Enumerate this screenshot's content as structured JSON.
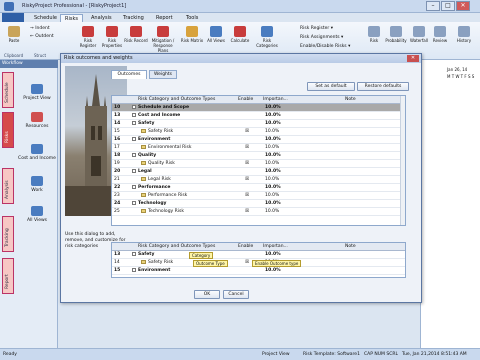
{
  "window": {
    "title": "RiskyProject Professional - [RiskyProject1]",
    "min": "–",
    "max": "□",
    "close": "✕"
  },
  "ribbon_tabs": [
    "Schedule",
    "Risks",
    "Analysis",
    "Tracking",
    "Report",
    "Tools"
  ],
  "ribbon": {
    "paste": "Paste",
    "indent": "Indent",
    "outdent": "Outdent",
    "clipboard_group": "Clipboard",
    "structure_group": "Struct",
    "buttons": [
      "Risk Register",
      "Risk Properties",
      "Risk Record",
      "Mitigation / Response Plans",
      "Risk Matrix",
      "All Views",
      "Calculate",
      "Risk Categories"
    ],
    "risk_register": "Risk Register ▾",
    "risk_assignments": "Risk Assignments ▾",
    "enable_disable": "Enable/Disable Risks ▾",
    "right_buttons": [
      "Risk",
      "Probability",
      "Waterfall",
      "Review",
      "History"
    ]
  },
  "workflow": {
    "title": "Workflow",
    "tabs": [
      "Schedule",
      "Risks",
      "Analysis",
      "Tracking",
      "Report"
    ],
    "items": [
      "Project View",
      "Resources",
      "Cost and Income",
      "Work",
      "All Views"
    ]
  },
  "dialog": {
    "title": "Risk outcomes and weights",
    "close": "✕",
    "tabs": [
      "Outcomes",
      "Weights"
    ],
    "set_default": "Set as default",
    "restore_defaults": "Restore defaults",
    "help_text": "Use this dialog to add, remove, and customize for risk categories",
    "ok": "OK",
    "cancel": "Cancel",
    "columns": [
      "Risk Category and Outcome Types",
      "Enable",
      "Importan...",
      "Note"
    ],
    "rows": [
      {
        "num": "10",
        "name": "Schedule and Scope",
        "enable": "",
        "imp": "10.0%",
        "type": "selected"
      },
      {
        "num": "13",
        "name": "Cost and Income",
        "enable": "",
        "imp": "10.0%",
        "type": "cat"
      },
      {
        "num": "14",
        "name": "Safety",
        "enable": "",
        "imp": "10.0%",
        "type": "cat"
      },
      {
        "num": "15",
        "name": "Safety Risk",
        "enable": "☒",
        "imp": "10.0%",
        "type": "risk"
      },
      {
        "num": "16",
        "name": "Environment",
        "enable": "",
        "imp": "10.0%",
        "type": "cat"
      },
      {
        "num": "17",
        "name": "Environmental Risk",
        "enable": "☒",
        "imp": "10.0%",
        "type": "risk"
      },
      {
        "num": "18",
        "name": "Quality",
        "enable": "",
        "imp": "10.0%",
        "type": "cat"
      },
      {
        "num": "19",
        "name": "Quality Risk",
        "enable": "☒",
        "imp": "10.0%",
        "type": "risk"
      },
      {
        "num": "20",
        "name": "Legal",
        "enable": "",
        "imp": "10.0%",
        "type": "cat"
      },
      {
        "num": "21",
        "name": "Legal Risk",
        "enable": "☒",
        "imp": "10.0%",
        "type": "risk"
      },
      {
        "num": "22",
        "name": "Performance",
        "enable": "",
        "imp": "10.0%",
        "type": "cat"
      },
      {
        "num": "23",
        "name": "Performance Risk",
        "enable": "☒",
        "imp": "10.0%",
        "type": "risk"
      },
      {
        "num": "24",
        "name": "Technology",
        "enable": "",
        "imp": "10.0%",
        "type": "cat"
      },
      {
        "num": "25",
        "name": "Technology Risk",
        "enable": "☒",
        "imp": "10.0%",
        "type": "risk"
      }
    ],
    "example_rows": [
      {
        "num": "13",
        "name": "Safety",
        "enable": "",
        "imp": "10.0%",
        "type": "cat"
      },
      {
        "num": "14",
        "name": "Safety Risk",
        "enable": "☒",
        "imp": "10.0%",
        "type": "risk"
      },
      {
        "num": "15",
        "name": "Environment",
        "enable": "",
        "imp": "10.0%",
        "type": "cat"
      }
    ],
    "tips": {
      "category": "Category",
      "outcome_type": "Outcome Type",
      "enable_outcome": "Enable Outcome type"
    }
  },
  "bg": {
    "date": "Jan 26, 14",
    "day_letters": "M T W T F S S"
  },
  "status": {
    "left": "Ready",
    "view": "Project View",
    "template": "Risk Template: Software1",
    "keys": "CAP NUM SCRL",
    "datetime": "Tue, Jan 21,2014   8:51:43 AM"
  }
}
